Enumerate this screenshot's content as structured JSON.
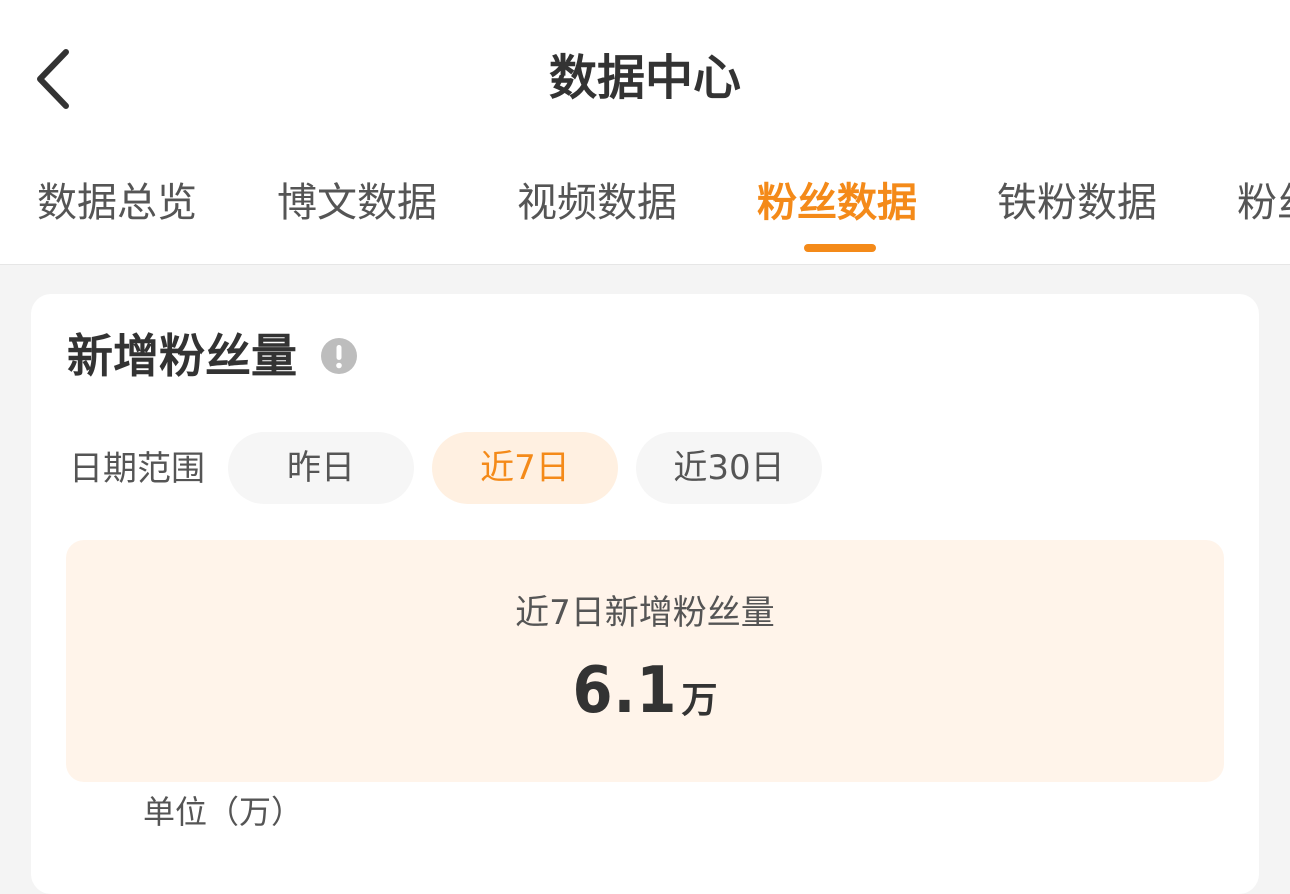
{
  "header": {
    "title": "数据中心"
  },
  "tabs": [
    {
      "label": "数据总览",
      "active": false
    },
    {
      "label": "博文数据",
      "active": false
    },
    {
      "label": "视频数据",
      "active": false
    },
    {
      "label": "粉丝数据",
      "active": true
    },
    {
      "label": "铁粉数据",
      "active": false
    },
    {
      "label": "粉丝",
      "active": false
    }
  ],
  "card": {
    "title": "新增粉丝量",
    "date_range_label": "日期范围",
    "ranges": [
      {
        "label": "昨日",
        "active": false
      },
      {
        "label": "近7日",
        "active": true
      },
      {
        "label": "近30日",
        "active": false
      }
    ],
    "summary": {
      "label": "近7日新增粉丝量",
      "value": "6.1",
      "unit": "万"
    },
    "unit_note": "单位（万）"
  },
  "colors": {
    "accent": "#f48a19",
    "chip_active_bg": "#fff0e1",
    "summary_bg": "#fff4ea",
    "page_bg": "#f4f4f4"
  },
  "icons": {
    "back": "chevron-left-icon",
    "info": "info-icon"
  }
}
